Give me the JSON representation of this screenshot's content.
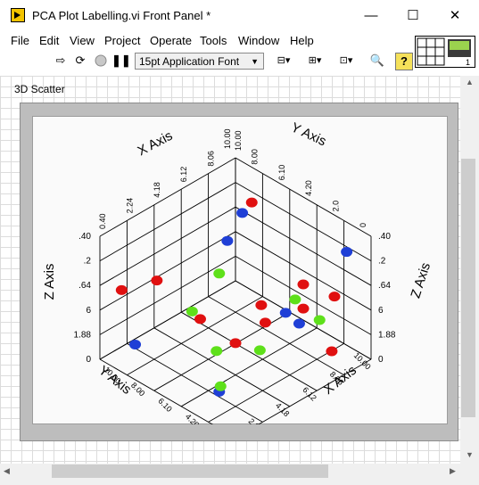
{
  "window": {
    "title": "PCA Plot Labelling.vi Front Panel *"
  },
  "controls": {
    "minimize": "—",
    "maximize": "☐",
    "close": "✕"
  },
  "menu": [
    "File",
    "Edit",
    "View",
    "Project",
    "Operate",
    "Tools",
    "Window",
    "Help"
  ],
  "toolbar": {
    "font": "15pt Application Font"
  },
  "panel": {
    "label": "3D Scatter"
  },
  "chart_data": {
    "type": "scatter",
    "title": "",
    "axes": {
      "x": {
        "label": "X Axis",
        "ticks": [
          "0",
          "2.0",
          "4.20",
          "6.10",
          "8.00",
          "10.00"
        ]
      },
      "y": {
        "label": "Y Axis",
        "ticks": [
          "0.40",
          "2.24",
          "4.18",
          "6.12",
          "8.06",
          "10.00"
        ]
      },
      "z": {
        "label": "Z Axis",
        "ticks": [
          "0",
          "1.88",
          "6",
          ".64",
          ".2",
          ".40"
        ]
      }
    },
    "series": [
      {
        "color": "#1f3fd6",
        "points": [
          [
            1.0,
            9.2,
            8.6
          ],
          [
            7.8,
            8.3,
            8.0
          ],
          [
            1.0,
            5.7,
            5.0
          ],
          [
            2.2,
            1.0,
            1.7
          ],
          [
            8.7,
            1.3,
            1.2
          ],
          [
            7.2,
            6.6,
            7.2
          ],
          [
            3.6,
            7.3,
            3.2
          ]
        ]
      },
      {
        "color": "#e01010",
        "points": [
          [
            0.8,
            8.1,
            5.8
          ],
          [
            1.0,
            6.0,
            8.0
          ],
          [
            2.0,
            4.2,
            5.4
          ],
          [
            4.0,
            1.4,
            6.2
          ],
          [
            9.3,
            0.9,
            5.5
          ],
          [
            0.4,
            5.4,
            6.8
          ],
          [
            8.2,
            9.4,
            7.9
          ],
          [
            5.7,
            7.6,
            2.3
          ],
          [
            3.6,
            3.6,
            3.1
          ],
          [
            7.2,
            1.4,
            7.3
          ],
          [
            1.1,
            8.2,
            1.1
          ]
        ]
      },
      {
        "color": "#5ee01a",
        "points": [
          [
            6.2,
            3.0,
            4.4
          ],
          [
            3.4,
            7.8,
            4.1
          ],
          [
            2.6,
            8.8,
            2.3
          ],
          [
            3.5,
            5.3,
            1.5
          ],
          [
            8.4,
            7.2,
            3.4
          ],
          [
            2.5,
            1.4,
            1.7
          ],
          [
            5.6,
            4.2,
            0.8
          ]
        ]
      }
    ]
  }
}
